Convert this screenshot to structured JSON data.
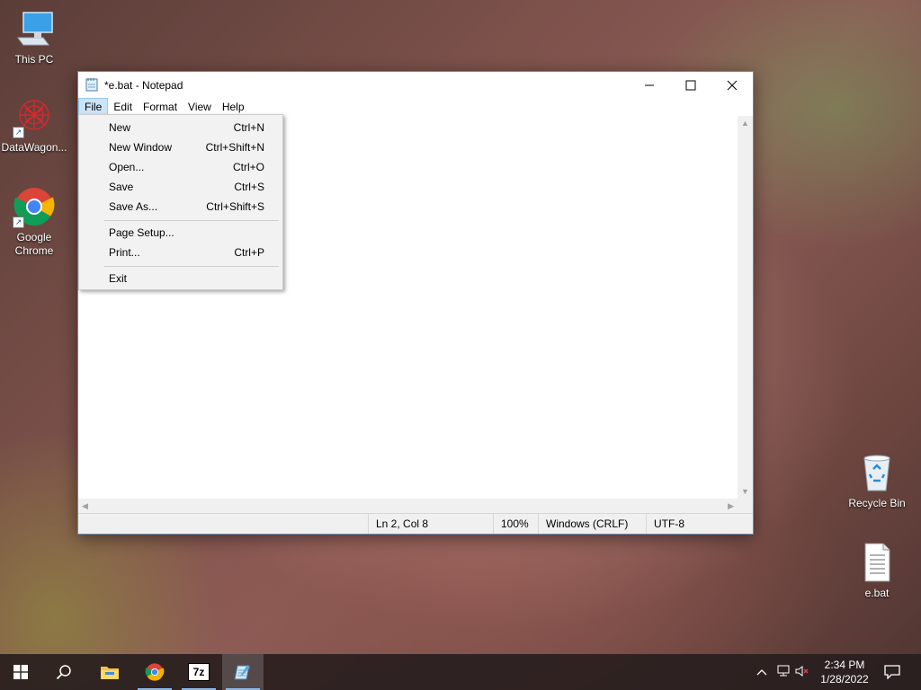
{
  "desktop": {
    "icons_left": [
      {
        "label": "This PC"
      },
      {
        "label": "DataWagon..."
      },
      {
        "label": "Google\nChrome"
      }
    ],
    "icons_right": [
      {
        "label": "Recycle Bin"
      },
      {
        "label": "e.bat"
      }
    ]
  },
  "window": {
    "title": "*e.bat - Notepad",
    "menus": [
      "File",
      "Edit",
      "Format",
      "View",
      "Help"
    ],
    "status": {
      "position": "Ln 2, Col 8",
      "zoom": "100%",
      "line_ending": "Windows (CRLF)",
      "encoding": "UTF-8"
    }
  },
  "file_menu": {
    "items": [
      {
        "label": "New",
        "shortcut": "Ctrl+N"
      },
      {
        "label": "New Window",
        "shortcut": "Ctrl+Shift+N"
      },
      {
        "label": "Open...",
        "shortcut": "Ctrl+O"
      },
      {
        "label": "Save",
        "shortcut": "Ctrl+S"
      },
      {
        "label": "Save As...",
        "shortcut": "Ctrl+Shift+S"
      },
      {
        "label": "Page Setup...",
        "shortcut": ""
      },
      {
        "label": "Print...",
        "shortcut": "Ctrl+P"
      },
      {
        "label": "Exit",
        "shortcut": ""
      }
    ]
  },
  "taskbar": {
    "clock_time": "2:34 PM",
    "clock_date": "1/28/2022",
    "icons": [
      "windows-start-icon",
      "search-icon",
      "file-explorer-icon",
      "chrome-icon",
      "7zip-icon",
      "notepad-icon"
    ],
    "sevenzip_label": "7z"
  },
  "colors": {
    "menu_highlight": "#cce4f7",
    "taskbar_bg": "#2a1e1e",
    "accent": "#0078d7"
  }
}
